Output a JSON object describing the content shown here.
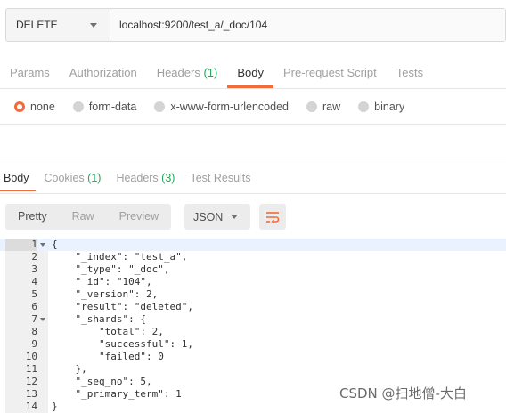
{
  "request": {
    "method": "DELETE",
    "url": "localhost:9200/test_a/_doc/104"
  },
  "request_tabs": [
    {
      "label": "Params",
      "count": "",
      "active": false
    },
    {
      "label": "Authorization",
      "count": "",
      "active": false
    },
    {
      "label": "Headers",
      "count": "(1)",
      "active": false
    },
    {
      "label": "Body",
      "count": "",
      "active": true
    },
    {
      "label": "Pre-request Script",
      "count": "",
      "active": false
    },
    {
      "label": "Tests",
      "count": "",
      "active": false
    }
  ],
  "body_types": [
    {
      "label": "none",
      "selected": true
    },
    {
      "label": "form-data",
      "selected": false
    },
    {
      "label": "x-www-form-urlencoded",
      "selected": false
    },
    {
      "label": "raw",
      "selected": false
    },
    {
      "label": "binary",
      "selected": false
    }
  ],
  "response_tabs": [
    {
      "label": "Body",
      "count": "",
      "active": true
    },
    {
      "label": "Cookies",
      "count": "(1)",
      "active": false
    },
    {
      "label": "Headers",
      "count": "(3)",
      "active": false
    },
    {
      "label": "Test Results",
      "count": "",
      "active": false
    }
  ],
  "view_modes": [
    {
      "label": "Pretty",
      "active": true
    },
    {
      "label": "Raw",
      "active": false
    },
    {
      "label": "Preview",
      "active": false
    }
  ],
  "format": "JSON",
  "icons": {
    "wrap": "wrap-lines-icon",
    "method_caret": "chevron-down-icon",
    "format_caret": "chevron-down-icon"
  },
  "colors": {
    "accent": "#f26b3a",
    "count": "#26a65b"
  },
  "code_lines": [
    {
      "num": "1",
      "fold": true,
      "text": "{"
    },
    {
      "num": "2",
      "fold": false,
      "text": "    \"_index\": \"test_a\","
    },
    {
      "num": "3",
      "fold": false,
      "text": "    \"_type\": \"_doc\","
    },
    {
      "num": "4",
      "fold": false,
      "text": "    \"_id\": \"104\","
    },
    {
      "num": "5",
      "fold": false,
      "text": "    \"_version\": 2,"
    },
    {
      "num": "6",
      "fold": false,
      "text": "    \"result\": \"deleted\","
    },
    {
      "num": "7",
      "fold": true,
      "text": "    \"_shards\": {"
    },
    {
      "num": "8",
      "fold": false,
      "text": "        \"total\": 2,"
    },
    {
      "num": "9",
      "fold": false,
      "text": "        \"successful\": 1,"
    },
    {
      "num": "10",
      "fold": false,
      "text": "        \"failed\": 0"
    },
    {
      "num": "11",
      "fold": false,
      "text": "    },"
    },
    {
      "num": "12",
      "fold": false,
      "text": "    \"_seq_no\": 5,"
    },
    {
      "num": "13",
      "fold": false,
      "text": "    \"_primary_term\": 1"
    },
    {
      "num": "14",
      "fold": false,
      "text": "}"
    }
  ],
  "watermark": "CSDN @扫地僧-大白"
}
